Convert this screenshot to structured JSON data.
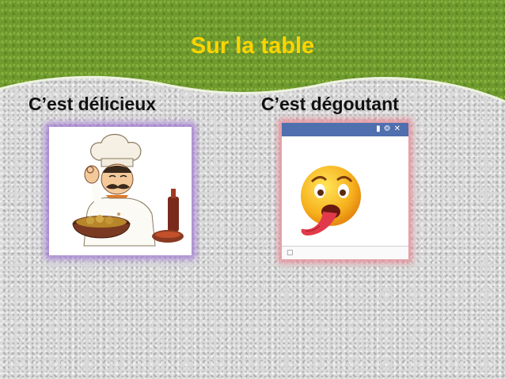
{
  "slide": {
    "title": "Sur la table",
    "left_label": "C’est délicieux",
    "right_label": "C’est dégoutant"
  },
  "icons": {
    "chat_window": [
      "video-icon",
      "gear-icon",
      "close-icon"
    ],
    "chat_close": "✕",
    "chat_gear": "⚙",
    "chat_video": "▮",
    "chat_bottom": "▢"
  },
  "colors": {
    "title": "#ffd400",
    "banner": "#6f9a2e",
    "chat_bar": "#4f6fae"
  }
}
